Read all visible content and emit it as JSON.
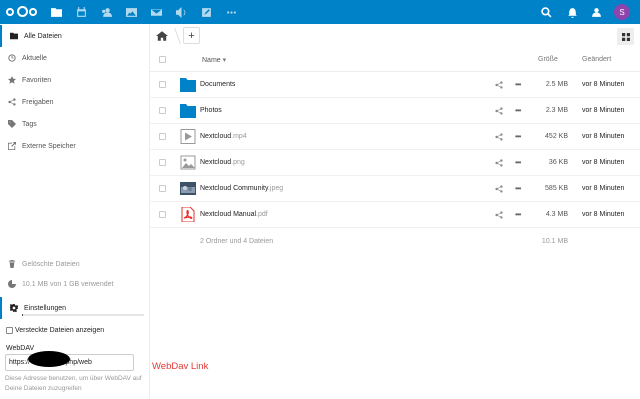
{
  "topbar": {
    "apps": [
      "files-icon",
      "calendar-icon",
      "contacts-icon",
      "photos-icon",
      "mail-icon",
      "audio-icon",
      "notes-icon",
      "more-apps-icon"
    ],
    "avatar_letter": "S",
    "color": "#0082c9"
  },
  "sidebar": {
    "items": [
      {
        "label": "Alle Dateien",
        "icon": "folder-icon"
      },
      {
        "label": "Aktuelle",
        "icon": "clock-icon"
      },
      {
        "label": "Favoriten",
        "icon": "star-icon"
      },
      {
        "label": "Freigaben",
        "icon": "share-icon"
      },
      {
        "label": "Tags",
        "icon": "tag-icon"
      },
      {
        "label": "Externe Speicher",
        "icon": "external-storage-icon"
      }
    ],
    "deleted_label": "Gelöschte Dateien",
    "quota_label": "10.1 MB von 1 GB verwendet",
    "quota_fraction": 0.01,
    "settings_label": "Einstellungen",
    "hidden_files_label": "Versteckte Dateien anzeigen",
    "webdav_label": "WebDAV",
    "webdav_value": "https://                    de/remote.php/web",
    "webdav_hint": "Diese Adresse benutzen, um über WebDAV auf Deine Dateien zuzugreifen"
  },
  "annotation": "WebDav Link",
  "table": {
    "col_name": "Name",
    "col_size": "Größe",
    "col_modified": "Geändert",
    "rows": [
      {
        "name": "Documents",
        "ext": "",
        "size": "2.5 MB",
        "modified": "vor 8 Minuten",
        "type": "folder"
      },
      {
        "name": "Photos",
        "ext": "",
        "size": "2.3 MB",
        "modified": "vor 8 Minuten",
        "type": "folder"
      },
      {
        "name": "Nextcloud",
        "ext": ".mp4",
        "size": "452 KB",
        "modified": "vor 8 Minuten",
        "type": "video"
      },
      {
        "name": "Nextcloud",
        "ext": ".png",
        "size": "36 KB",
        "modified": "vor 8 Minuten",
        "type": "image"
      },
      {
        "name": "Nextcloud Community",
        "ext": ".jpeg",
        "size": "585 KB",
        "modified": "vor 8 Minuten",
        "type": "photo"
      },
      {
        "name": "Nextcloud Manual",
        "ext": ".pdf",
        "size": "4.3 MB",
        "modified": "vor 8 Minuten",
        "type": "pdf"
      }
    ],
    "summary_count": "2 Ordner und 4 Dateien",
    "summary_size": "10.1 MB"
  }
}
